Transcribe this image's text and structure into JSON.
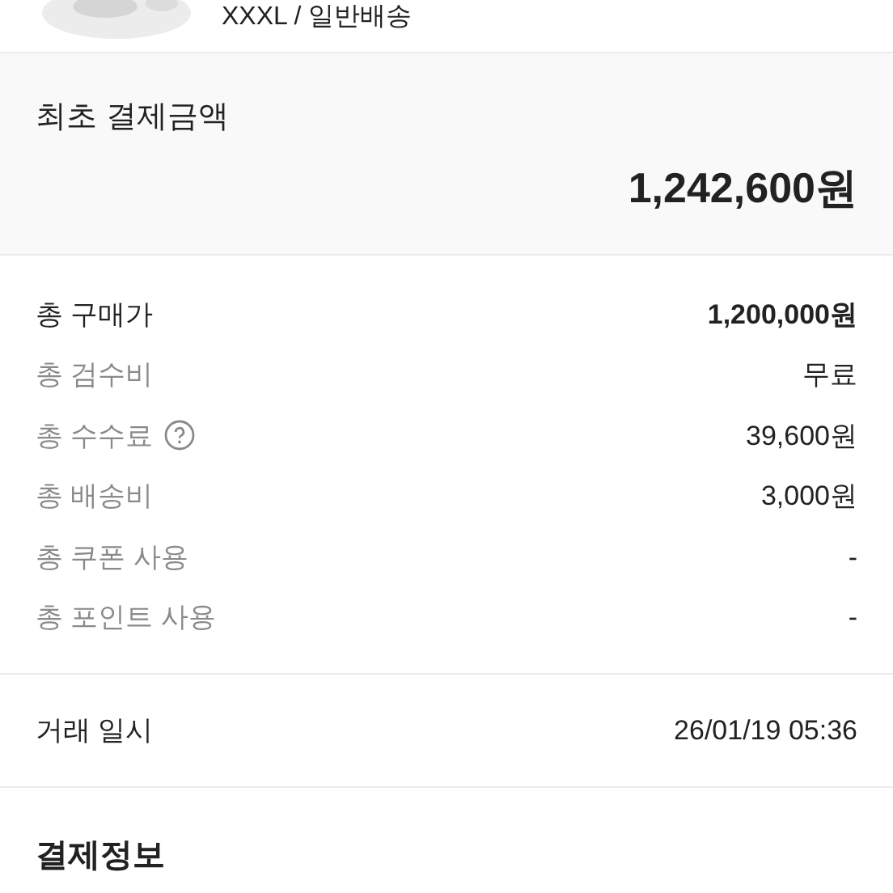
{
  "product": {
    "kind": "picture",
    "option": "XXXL / 일반배송"
  },
  "initial_payment": {
    "title": "최초 결제금액",
    "amount": "1,242,600원"
  },
  "breakdown": [
    {
      "label": "총 구매가",
      "value": "1,200,000원",
      "primary": true,
      "help": false
    },
    {
      "label": "총 검수비",
      "value": "무료",
      "primary": false,
      "help": false
    },
    {
      "label": "총 수수료",
      "value": "39,600원",
      "primary": false,
      "help": true
    },
    {
      "label": "총 배송비",
      "value": "3,000원",
      "primary": false,
      "help": false
    },
    {
      "label": "총 쿠폰 사용",
      "value": "-",
      "primary": false,
      "help": false
    },
    {
      "label": "총 포인트 사용",
      "value": "-",
      "primary": false,
      "help": false
    }
  ],
  "transaction": {
    "label": "거래 일시",
    "value": "26/01/19 05:36"
  },
  "payment_info": {
    "title": "결제정보"
  }
}
